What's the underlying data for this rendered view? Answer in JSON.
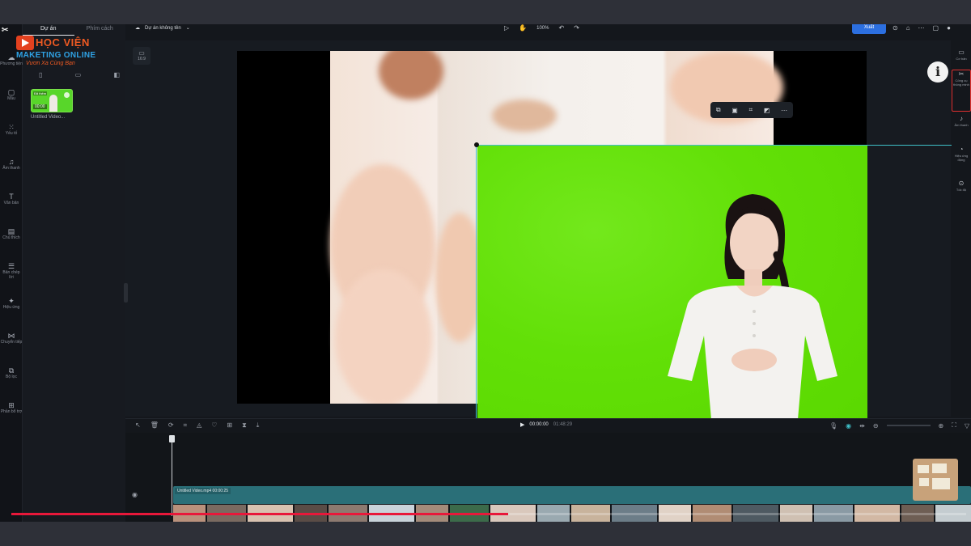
{
  "header": {
    "project_name": "Dự án không tên",
    "zoom": "100%",
    "export_label": "Xuất"
  },
  "brand": {
    "line1": "HỌC VIỆN",
    "line2": "MAKETING ONLINE",
    "line3": "Vươn Xa Cùng Bạn"
  },
  "left_panel": {
    "tabs": [
      "Dự án",
      "Phím cách"
    ],
    "media_item": {
      "name": "Untitled Video...",
      "tag": "Đã thêm",
      "duration": "00:00"
    }
  },
  "left_rail": {
    "items": [
      {
        "label": "Phương tiện",
        "icon": "media-icon"
      },
      {
        "label": "Mẫu",
        "icon": "template-icon"
      },
      {
        "label": "Yếu tố",
        "icon": "elements-icon"
      },
      {
        "label": "Âm thanh",
        "icon": "audio-icon"
      },
      {
        "label": "Văn bản",
        "icon": "text-icon"
      },
      {
        "label": "Chú thích",
        "icon": "captions-icon"
      },
      {
        "label": "Bản chép lời",
        "icon": "transcript-icon"
      },
      {
        "label": "Hiệu ứng",
        "icon": "effects-icon"
      },
      {
        "label": "Chuyển tiếp",
        "icon": "transition-icon"
      },
      {
        "label": "Bộ lọc",
        "icon": "filter-icon"
      },
      {
        "label": "Phần bổ trợ",
        "icon": "plugins-icon"
      }
    ]
  },
  "preview": {
    "ratio_label": "16:9"
  },
  "right_tools": [
    {
      "label": "Cơ bản",
      "icon": "basic-icon",
      "highlighted": false
    },
    {
      "label": "Công cụ thông minh",
      "icon": "smart-tools-icon",
      "highlighted": true
    },
    {
      "label": "Âm thanh",
      "icon": "audio-icon",
      "highlighted": false
    },
    {
      "label": "Hiệu ứng động",
      "icon": "animation-icon",
      "highlighted": false
    },
    {
      "label": "Tốc độ",
      "icon": "speed-icon",
      "highlighted": false
    }
  ],
  "timeline": {
    "current_time": "00:00:00",
    "total_time": "01:48:29",
    "clip_label": "Untitled Video.mp4   00:00:25"
  },
  "video_progress": 0.52,
  "colors": {
    "accent": "#2c6fe0",
    "green_screen": "#62e007",
    "selection": "#3fc0c8",
    "progress": "#e8183a"
  }
}
